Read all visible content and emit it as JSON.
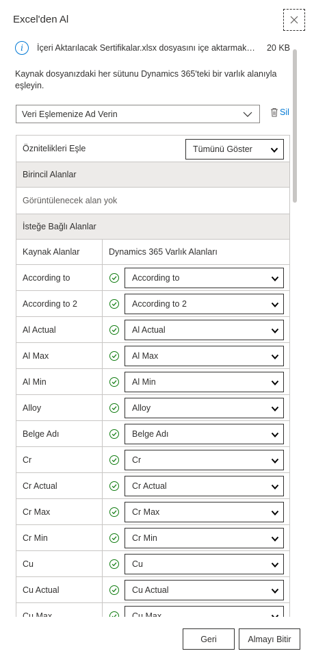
{
  "dialog": {
    "title": "Excel'den Al",
    "close_icon": "close-icon"
  },
  "file": {
    "text": "İçeri Aktarılacak Sertifikalar.xlsx dosyasını içe aktarmak ...",
    "size": "20 KB",
    "icon": "info-icon"
  },
  "instruction": "Kaynak dosyanızdaki her sütunu Dynamics 365'teki bir varlık alanıyla eşleyin.",
  "mapping_name": {
    "value": "Veri Eşlemenize Ad Verin",
    "delete_label": "Sil"
  },
  "table": {
    "attributes_header": "Öznitelikleri Eşle",
    "show_all": "Tümünü Göster",
    "primary_section": "Birincil Alanlar",
    "primary_empty": "Görüntülenecek alan yok",
    "optional_section": "İsteğe Bağlı Alanlar",
    "col_source": "Kaynak Alanlar",
    "col_target": "Dynamics 365 Varlık Alanları",
    "rows": [
      {
        "source": "According to",
        "target": "According to"
      },
      {
        "source": "According to 2",
        "target": "According to 2"
      },
      {
        "source": "Al Actual",
        "target": "Al Actual"
      },
      {
        "source": "Al Max",
        "target": "Al Max"
      },
      {
        "source": "Al Min",
        "target": "Al Min"
      },
      {
        "source": "Alloy",
        "target": "Alloy"
      },
      {
        "source": "Belge Adı",
        "target": "Belge Adı"
      },
      {
        "source": "Cr",
        "target": "Cr"
      },
      {
        "source": "Cr Actual",
        "target": "Cr Actual"
      },
      {
        "source": "Cr Max",
        "target": "Cr Max"
      },
      {
        "source": "Cr Min",
        "target": "Cr Min"
      },
      {
        "source": "Cu",
        "target": "Cu"
      },
      {
        "source": "Cu Actual",
        "target": "Cu Actual"
      },
      {
        "source": "Cu Max",
        "target": "Cu Max"
      }
    ]
  },
  "footer": {
    "back": "Geri",
    "finish": "Almayı Bitir"
  },
  "colors": {
    "accent": "#0078d4",
    "success": "#107c10",
    "section_bg": "#edebe9"
  }
}
